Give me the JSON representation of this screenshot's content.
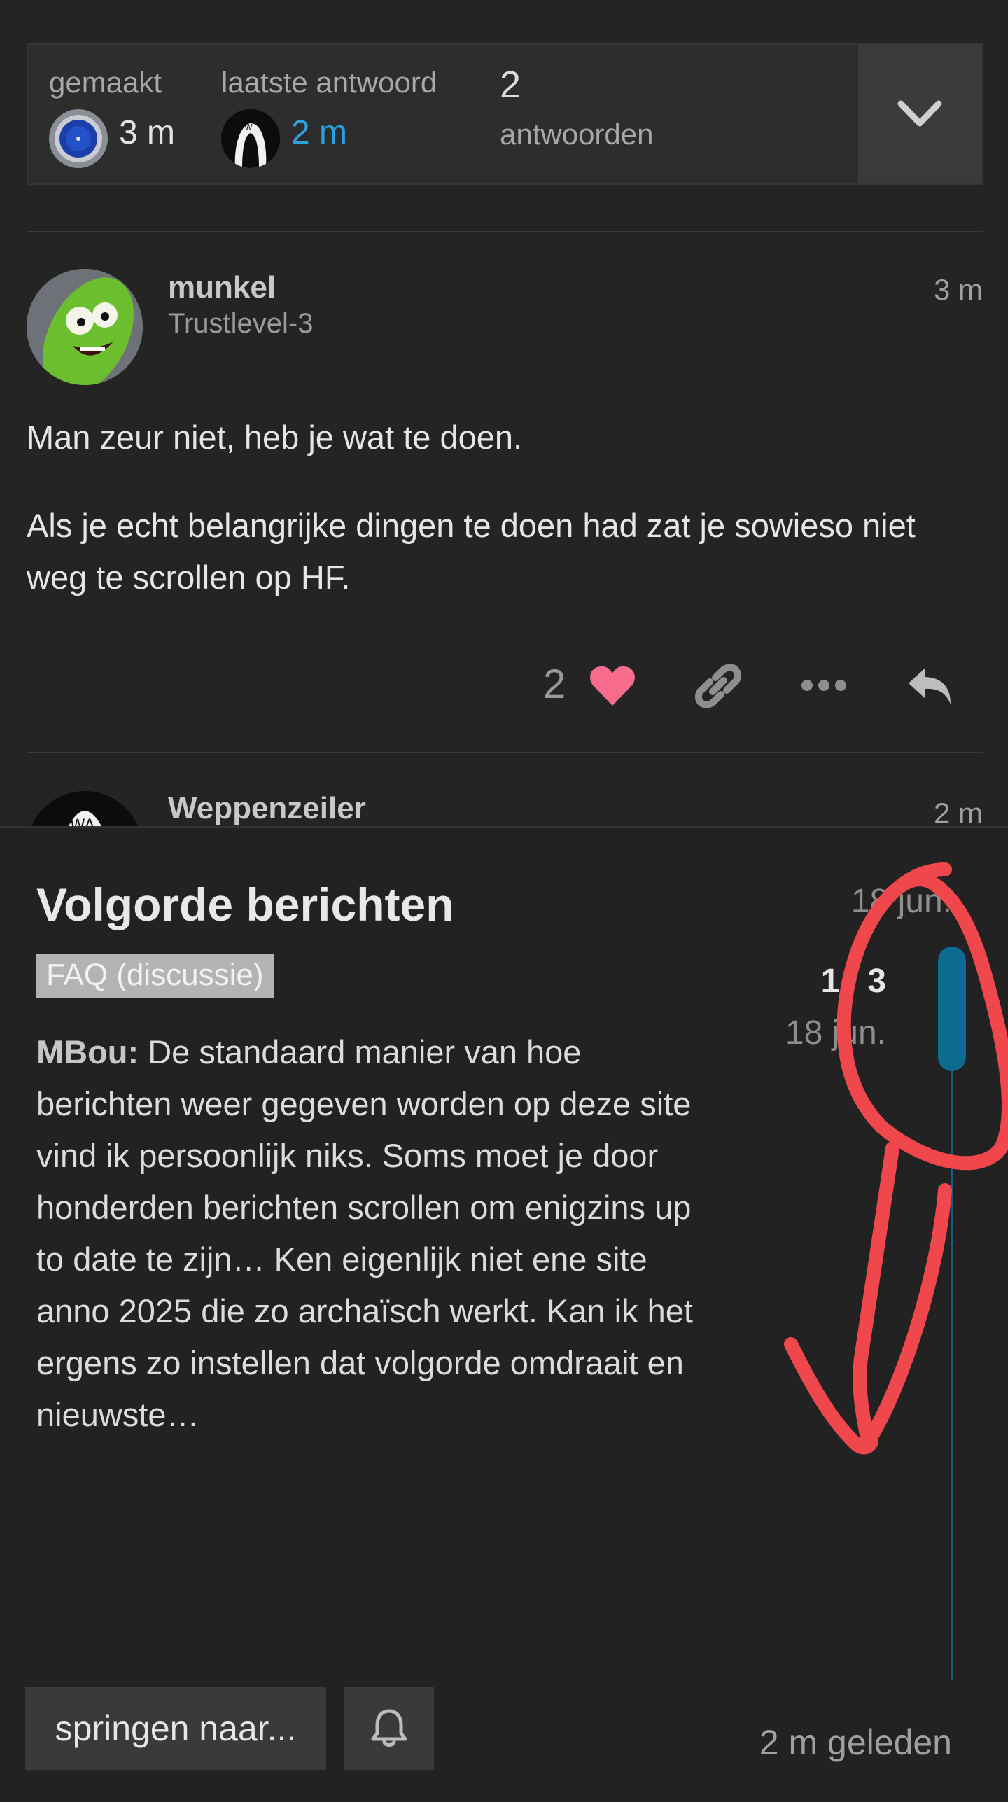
{
  "topic_map": {
    "created_label": "gemaakt",
    "created_value": "3 m",
    "last_reply_label": "laatste antwoord",
    "last_reply_value": "2 m",
    "reply_count": "2",
    "replies_label": "antwoorden"
  },
  "post": {
    "username": "munkel",
    "user_title": "Trustlevel-3",
    "age": "3 m",
    "paragraphs": [
      "Man zeur niet, heb je wat te doen.",
      "Als je echt belangrijke dingen te doen had zat je sowieso niet weg te scrollen op HF."
    ],
    "like_count": "2"
  },
  "next_post": {
    "username": "Weppenzeiler",
    "age": "2 m"
  },
  "timeline": {
    "title": "Volgorde berichten",
    "category": "FAQ (discussie)",
    "excerpt_author": "MBou:",
    "excerpt_text": "De standaard manier van hoe berichten weer gegeven worden op deze site vind ik persoonlijk niks. Soms moet je door honderden berichten scrollen om enigzins up to date te zijn… Ken eigenlijk niet ene site anno 2025 die zo archaïsch werkt. Kan ik het ergens zo instellen dat volgorde omdraait en nieuwste…",
    "start_date": "18 jun.",
    "position": "1 / 3",
    "position_date": "18 jun.",
    "jump_button": "springen naar...",
    "last_activity": "2 m geleden"
  },
  "colors": {
    "accent_blue": "#2ba2e0",
    "timeline_blue": "#0d6a91",
    "like_pink": "#fa6c8d",
    "annotation_red": "#f0474d"
  }
}
